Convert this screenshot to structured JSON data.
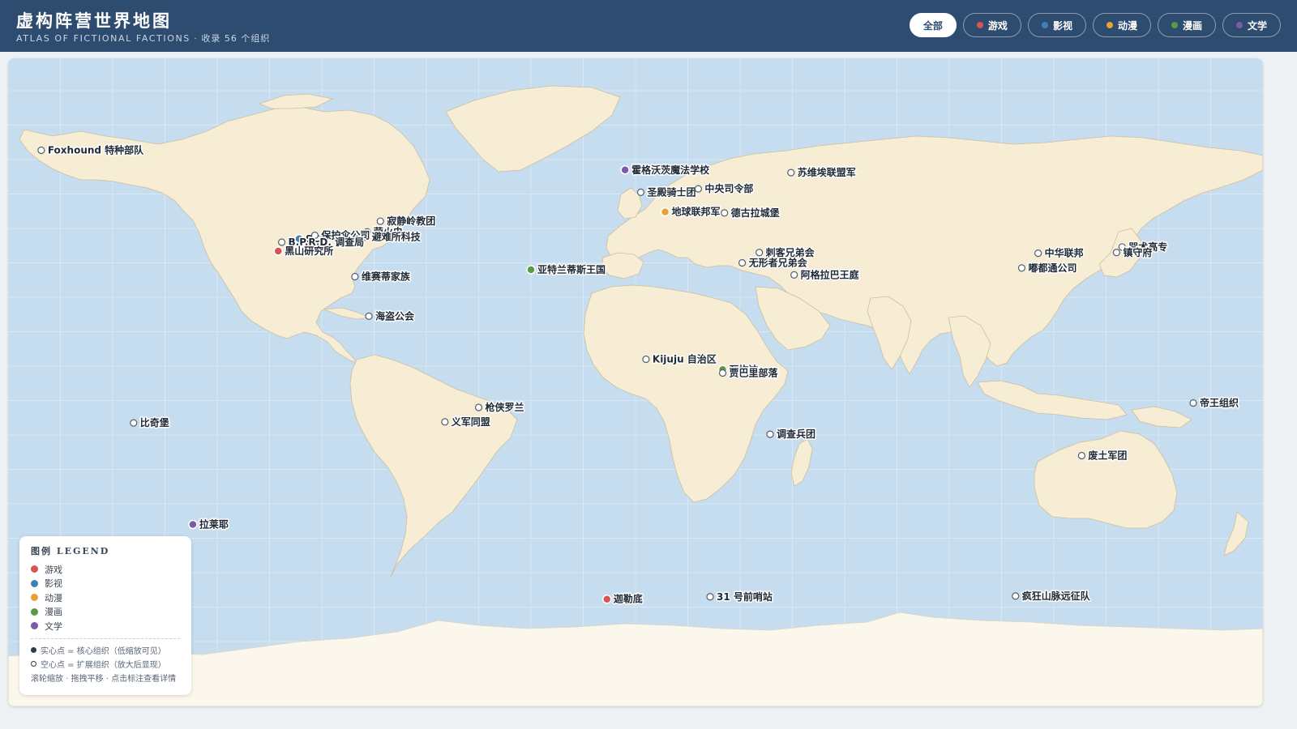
{
  "header": {
    "title": "虚构阵营世界地图",
    "subtitle_en": "ATLAS OF FICTIONAL FACTIONS",
    "subtitle_count": "· 收录 56 个组织"
  },
  "filters": [
    {
      "label": "全部",
      "active": true,
      "color": ""
    },
    {
      "label": "游戏",
      "active": false,
      "color": "#d9534f"
    },
    {
      "label": "影视",
      "active": false,
      "color": "#3f7fb5"
    },
    {
      "label": "动漫",
      "active": false,
      "color": "#e8a233"
    },
    {
      "label": "漫画",
      "active": false,
      "color": "#5a9a47"
    },
    {
      "label": "文学",
      "active": false,
      "color": "#7c5aa6"
    }
  ],
  "colors": {
    "ocean": "#c6dcef",
    "land": "#f7edd5",
    "header": "#2e4c6f",
    "游戏": "#d9534f",
    "影视": "#3f7fb5",
    "动漫": "#e8a233",
    "漫画": "#5a9a47",
    "文学": "#7c5aa6"
  },
  "markers": [
    {
      "name": "Foxhound 特种部队",
      "lon": -170.5,
      "lat": 62.7,
      "type": "ext"
    },
    {
      "name": "霍格沃茨魔法学校",
      "lon": -3.0,
      "lat": 57.0,
      "type": "core",
      "category": "文学"
    },
    {
      "name": "圣殿骑士团",
      "lon": 1.5,
      "lat": 50.5,
      "type": "ext"
    },
    {
      "name": "中央司令部",
      "lon": 18.0,
      "lat": 51.5,
      "type": "ext"
    },
    {
      "name": "苏维埃联盟军",
      "lon": 44.6,
      "lat": 56.2,
      "type": "ext"
    },
    {
      "name": "地球联邦军",
      "lon": 8.5,
      "lat": 44.8,
      "type": "core",
      "category": "动漫"
    },
    {
      "name": "德古拉城堡",
      "lon": 25.5,
      "lat": 44.5,
      "type": "ext"
    },
    {
      "name": "寂静岭教团",
      "lon": -73.2,
      "lat": 42.1,
      "type": "ext"
    },
    {
      "name": "萤火虫",
      "lon": -77.0,
      "lat": 39.0,
      "type": "ext"
    },
    {
      "name": "避难所科技",
      "lon": -77.5,
      "lat": 37.5,
      "type": "ext"
    },
    {
      "name": "SCP",
      "lon": -96.5,
      "lat": 37.0,
      "type": "core",
      "category": "影视"
    },
    {
      "name": "保护伞公司",
      "lon": -92.0,
      "lat": 38.0,
      "type": "ext"
    },
    {
      "name": "B.P.R.D. 调查局",
      "lon": -101.5,
      "lat": 36.0,
      "type": "ext"
    },
    {
      "name": "黑山研究所",
      "lon": -102.5,
      "lat": 33.4,
      "type": "core",
      "category": "游戏"
    },
    {
      "name": "维赛蒂家族",
      "lon": -80.5,
      "lat": 26.0,
      "type": "ext"
    },
    {
      "name": "海盗公会",
      "lon": -76.5,
      "lat": 14.5,
      "type": "ext"
    },
    {
      "name": "亚特兰蒂斯王国",
      "lon": -30.0,
      "lat": 28.0,
      "type": "core",
      "category": "漫画"
    },
    {
      "name": "刺客兄弟会",
      "lon": 35.5,
      "lat": 33.0,
      "type": "ext"
    },
    {
      "name": "无形者兄弟会",
      "lon": 30.6,
      "lat": 30.0,
      "type": "ext"
    },
    {
      "name": "阿格拉巴王庭",
      "lon": 45.5,
      "lat": 26.5,
      "type": "ext"
    },
    {
      "name": "中华联邦",
      "lon": 115.5,
      "lat": 32.8,
      "type": "ext"
    },
    {
      "name": "嘟都通公司",
      "lon": 110.8,
      "lat": 28.5,
      "type": "ext"
    },
    {
      "name": "咒术高专",
      "lon": 139.6,
      "lat": 34.6,
      "type": "ext"
    },
    {
      "name": "镇守府",
      "lon": 138.0,
      "lat": 33.0,
      "type": "ext"
    },
    {
      "name": "Kijuju 自治区",
      "lon": 3.0,
      "lat": 2.0,
      "type": "ext"
    },
    {
      "name": "瓦坎达",
      "lon": 25.0,
      "lat": -1.0,
      "type": "core",
      "category": "漫画"
    },
    {
      "name": "贾巴里部落",
      "lon": 25.0,
      "lat": -2.0,
      "type": "ext"
    },
    {
      "name": "调查兵团",
      "lon": 38.6,
      "lat": -19.8,
      "type": "ext"
    },
    {
      "name": "枪侠罗兰",
      "lon": -45.0,
      "lat": -12.0,
      "type": "ext"
    },
    {
      "name": "义军同盟",
      "lon": -54.7,
      "lat": -16.2,
      "type": "ext"
    },
    {
      "name": "比奇堡",
      "lon": -144.0,
      "lat": -16.5,
      "type": "ext"
    },
    {
      "name": "帝王组织",
      "lon": 160.0,
      "lat": -10.7,
      "type": "ext"
    },
    {
      "name": "废土军团",
      "lon": 128.0,
      "lat": -26.0,
      "type": "ext"
    },
    {
      "name": "拉莱耶",
      "lon": -127.0,
      "lat": -46.0,
      "type": "core",
      "category": "文学"
    },
    {
      "name": "迦勒底",
      "lon": -8.2,
      "lat": -67.7,
      "type": "core",
      "category": "游戏"
    },
    {
      "name": "31 号前哨站",
      "lon": 21.4,
      "lat": -67.0,
      "type": "ext"
    },
    {
      "name": "疯狂山脉远征队",
      "lon": 109.0,
      "lat": -66.8,
      "type": "ext"
    }
  ],
  "legend": {
    "title": "图例 LEGEND",
    "items": [
      {
        "label": "游戏",
        "color": "#d9534f"
      },
      {
        "label": "影视",
        "color": "#3f7fb5"
      },
      {
        "label": "动漫",
        "color": "#e8a233"
      },
      {
        "label": "漫画",
        "color": "#5a9a47"
      },
      {
        "label": "文学",
        "color": "#7c5aa6"
      }
    ],
    "note_core": "实心点 = 核心组织（低缩放可见）",
    "note_ext": "空心点 = 扩展组织（放大后显现）",
    "hint": "滚轮缩放 · 拖拽平移 · 点击标注查看详情"
  }
}
